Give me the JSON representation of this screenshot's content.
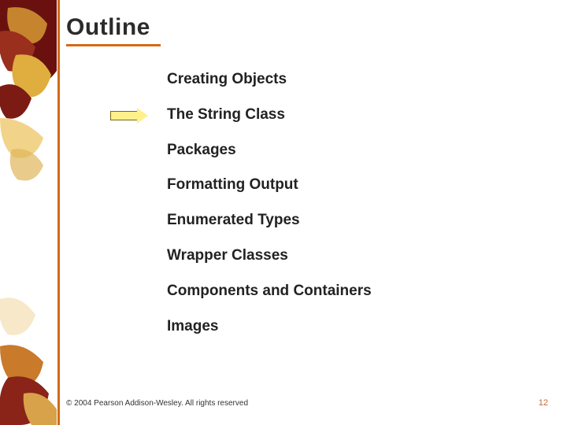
{
  "title": "Outline",
  "outline_items": [
    "Creating Objects",
    "The String Class",
    "Packages",
    "Formatting Output",
    "Enumerated Types",
    "Wrapper Classes",
    "Components and Containers",
    "Images"
  ],
  "pointer_index": 1,
  "footer": {
    "copyright": "© 2004 Pearson Addison-Wesley. All rights reserved",
    "page_number": "12"
  },
  "colors": {
    "accent": "#d36a1a",
    "pointer_fill": "#fff08a",
    "pointer_border": "#7a6a10"
  }
}
